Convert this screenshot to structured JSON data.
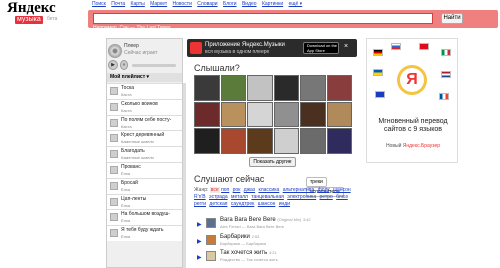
{
  "logo": {
    "name": "Яндекс",
    "service": "музыка",
    "beta": "бета"
  },
  "topnav": [
    "Поиск",
    "Почта",
    "Карты",
    "Маркет",
    "Новости",
    "Словари",
    "Блоги",
    "Видео",
    "Картинки",
    "ещё ▾"
  ],
  "search": {
    "value": "",
    "button": "Найти",
    "example_prefix": "Например,",
    "example": "Сан — The Last Tapes"
  },
  "player": {
    "now_label": "Плеер",
    "now_sub": "Сейчас играет"
  },
  "playlist": {
    "header": "Мой плейлист ▾",
    "items": [
      {
        "title": "Тоска",
        "artist": "Каста"
      },
      {
        "title": "Сколько воинов",
        "artist": "Каста"
      },
      {
        "title": "По полям себе посту-",
        "artist": "Каста"
      },
      {
        "title": "Крест деревянный",
        "artist": "Каменные шмели"
      },
      {
        "title": "Благодать",
        "artist": "Каменные шмели"
      },
      {
        "title": "Прованс",
        "artist": "Ёлка"
      },
      {
        "title": "Бросай",
        "artist": "Ёлка"
      },
      {
        "title": "Цап-ленты",
        "artist": "Ёлка"
      },
      {
        "title": "На большом воздуш-",
        "artist": "Ёлка"
      },
      {
        "title": "Я тебя буду ждать",
        "artist": "Ёлка"
      }
    ]
  },
  "banner": {
    "title": "Приложение Яндекс.Музыки",
    "sub": "вся музыка в одном плеере",
    "store": "Download on the App Store"
  },
  "heard": {
    "title": "Слышали?",
    "more_button": "Показать другие"
  },
  "listening": {
    "title": "Слушают сейчас",
    "tabs": [
      "треки",
      "исполнители"
    ],
    "genre_label": "Жанр:",
    "genre_selected": "все",
    "genres": [
      "поп",
      "рок",
      "джаз",
      "классика",
      "альтернатива",
      "фолк",
      "шансон",
      "R'n'B",
      "эстрада",
      "металл",
      "танцевальная",
      "электроника",
      "ретро",
      "блюз",
      "регги",
      "детская",
      "саундтрек",
      "шансон",
      "инди"
    ],
    "tracks": [
      {
        "title": "Bara Bara Bere Bere",
        "note": "(Original Mix)",
        "duration": "3:42",
        "artist": "Alex Ferrari — Bara Bara Bere Bere"
      },
      {
        "title": "Барбарики",
        "note": "",
        "duration": "2:53",
        "artist": "Барбарики — Барбарики"
      },
      {
        "title": "Так хочется жить",
        "note": "",
        "duration": "4:21",
        "artist": "Рождество — Так хочется жить"
      }
    ]
  },
  "ad": {
    "title": "Мгновенный перевод сайтов с 9 языков",
    "sub_prefix": "Новый ",
    "sub_brand": "Яндекс.Браузер"
  },
  "colors": {
    "accent": "#e5323c",
    "searchbar": "#f07f7f",
    "link": "#1a3dc1"
  }
}
